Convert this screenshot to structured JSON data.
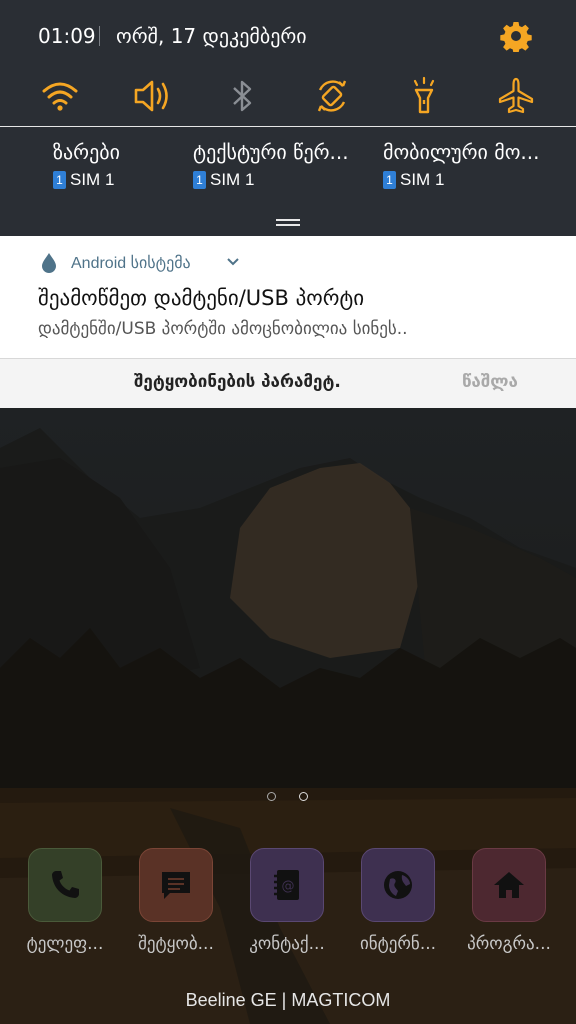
{
  "status": {
    "time": "01:09",
    "date": "ორშ, 17 დეკემბერი"
  },
  "quick_settings": [
    {
      "icon": "wifi-icon",
      "active": true
    },
    {
      "icon": "sound-icon",
      "active": true
    },
    {
      "icon": "bluetooth-icon",
      "active": false
    },
    {
      "icon": "auto-rotate-icon",
      "active": true
    },
    {
      "icon": "flashlight-icon",
      "active": false
    },
    {
      "icon": "airplane-mode-icon",
      "active": false
    }
  ],
  "sim_defaults": [
    {
      "title": "ზარები",
      "sim_number": "1",
      "sim_label": "SIM 1"
    },
    {
      "title": "ტექსტური წერ...",
      "sim_number": "1",
      "sim_label": "SIM 1"
    },
    {
      "title": "მობილური მო...",
      "sim_number": "1",
      "sim_label": "SIM 1"
    }
  ],
  "notification": {
    "app": "Android სისტემა",
    "title": "შეამოწმეთ დამტენი/USB პორტი",
    "text": "დამტენში/USB პორტში ამოცნობილია სინეს..",
    "settings_button": "შეტყობინების პარამეტ.",
    "clear_button": "წაშლა"
  },
  "dock": [
    {
      "icon": "phone-icon",
      "label": "ტელეფ..."
    },
    {
      "icon": "messages-icon",
      "label": "შეტყობ..."
    },
    {
      "icon": "contacts-icon",
      "label": "კონტაქ..."
    },
    {
      "icon": "internet-icon",
      "label": "ინტერნ..."
    },
    {
      "icon": "home-icon",
      "label": "პროგრა..."
    }
  ],
  "carrier": "Beeline GE | MAGTICOM",
  "colors": {
    "accent": "#f5a623",
    "shade": "#2a2e34",
    "app_name": "#4f7389",
    "sim_badge": "#2f7fd6"
  }
}
